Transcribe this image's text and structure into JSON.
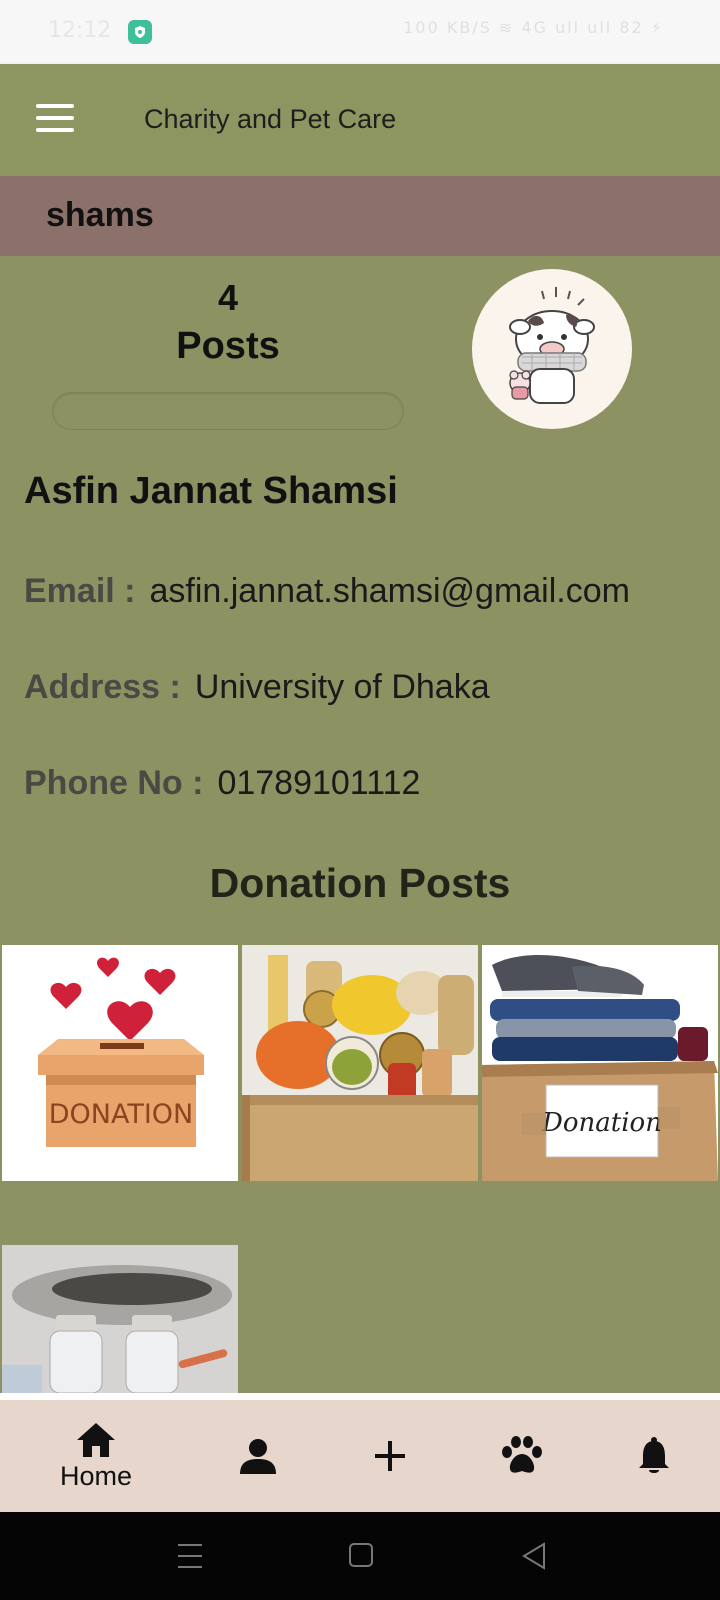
{
  "status_bar": {
    "time": "12:12",
    "right_text": "100 KB/S ≋ 4G ull ull 82 ⚡"
  },
  "app_bar": {
    "title": "Charity and Pet Care",
    "menu_icon": "hamburger-menu-icon"
  },
  "profile": {
    "username": "shams",
    "posts_count": "4",
    "posts_label": "Posts",
    "full_name": "Asfin Jannat Shamsi",
    "email_label": "Email :",
    "email": "asfin.jannat.shamsi@gmail.com",
    "address_label": "Address :",
    "address": "University of Dhaka",
    "phone_label": "Phone No :",
    "phone": "01789101112"
  },
  "section": {
    "title": "Donation Posts"
  },
  "posts": [
    {
      "image": "donation-box-hearts",
      "caption_text": "DONATION"
    },
    {
      "image": "food-groceries-box"
    },
    {
      "image": "clothes-donation-box",
      "caption_text": "Donation"
    },
    {
      "image": "medicine-vials"
    }
  ],
  "bottom_nav": {
    "items": [
      {
        "icon": "home-icon",
        "label": "Home"
      },
      {
        "icon": "person-icon"
      },
      {
        "icon": "plus-icon"
      },
      {
        "icon": "paw-icon"
      },
      {
        "icon": "bell-icon"
      }
    ]
  },
  "colors": {
    "background": "#8d9263",
    "app_bar": "#8d9560",
    "user_band": "#8c706a",
    "bottom_nav": "#e6d6cc"
  }
}
